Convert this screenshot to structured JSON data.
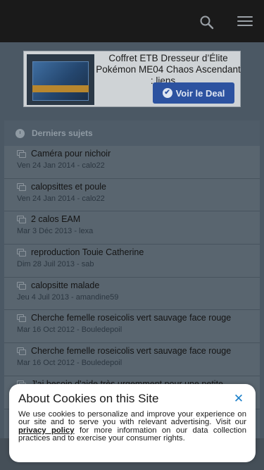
{
  "header": {
    "search_icon": "search-icon",
    "menu_icon": "hamburger-icon"
  },
  "ad": {
    "title": "Coffret ETB Dresseur d’Élite Pokémon ME04 Chaos Ascendant : liens ...",
    "cta_label": "Voir le Deal"
  },
  "recent": {
    "heading": "Derniers sujets",
    "topics": [
      {
        "title": "Caméra pour nichoir",
        "meta": "Ven 24 Jan 2014 - calo22"
      },
      {
        "title": "calopsittes et poule",
        "meta": "Ven 24 Jan 2014 - calo22"
      },
      {
        "title": "2 calos EAM",
        "meta": "Mar 3 Déc 2013 - lexa"
      },
      {
        "title": "reproduction Touie Catherine",
        "meta": "Dim 28 Juil 2013 - sab"
      },
      {
        "title": "calopsitte malade",
        "meta": "Jeu 4 Juil 2013 - amandine59"
      },
      {
        "title": "Cherche femelle roseicolis vert sauvage face rouge",
        "meta": "Mar 16 Oct 2012 - Bouledepoil"
      },
      {
        "title": "Cherche femelle roseicolis vert sauvage face rouge",
        "meta": "Mar 16 Oct 2012 - Bouledepoil"
      },
      {
        "title": "J'ai besoin d'aide très urgemment pour une petite",
        "meta": ""
      }
    ]
  },
  "cookie": {
    "title": "About Cookies on this Site",
    "text_before": "We use cookies to personalize and improve your experience on our site and to serve you with relevant advertising. Visit our ",
    "link": "privacy policy",
    "text_after": " for more information on our data collection practices and to exercise your consumer rights.",
    "close_label": "✕"
  }
}
